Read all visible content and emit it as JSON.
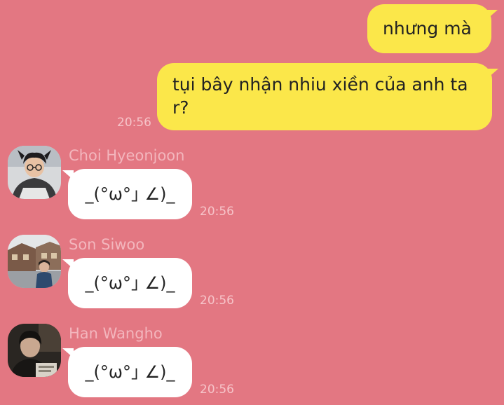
{
  "colors": {
    "background": "#e37782",
    "outgoing_bubble": "#fbe74a",
    "incoming_bubble": "#ffffff",
    "timestamp": "#f6c4c9",
    "sender_name": "#f3b6bd"
  },
  "outgoing": [
    {
      "text": "nhưng mà",
      "time": ""
    },
    {
      "text": "tụi bây nhận nhiu xiền của anh ta r?",
      "time": "20:56"
    }
  ],
  "incoming": [
    {
      "sender": "Choi Hyeonjoon",
      "text": "_(°ω°｣ ∠)_",
      "time": "20:56",
      "avatar_icon": "avatar-photo-hoodie-person"
    },
    {
      "sender": "Son Siwoo",
      "text": "_(°ω°｣ ∠)_",
      "time": "20:56",
      "avatar_icon": "avatar-photo-street-scene"
    },
    {
      "sender": "Han Wangho",
      "text": "_(°ω°｣ ∠)_",
      "time": "20:56",
      "avatar_icon": "avatar-photo-dark-portrait"
    }
  ]
}
